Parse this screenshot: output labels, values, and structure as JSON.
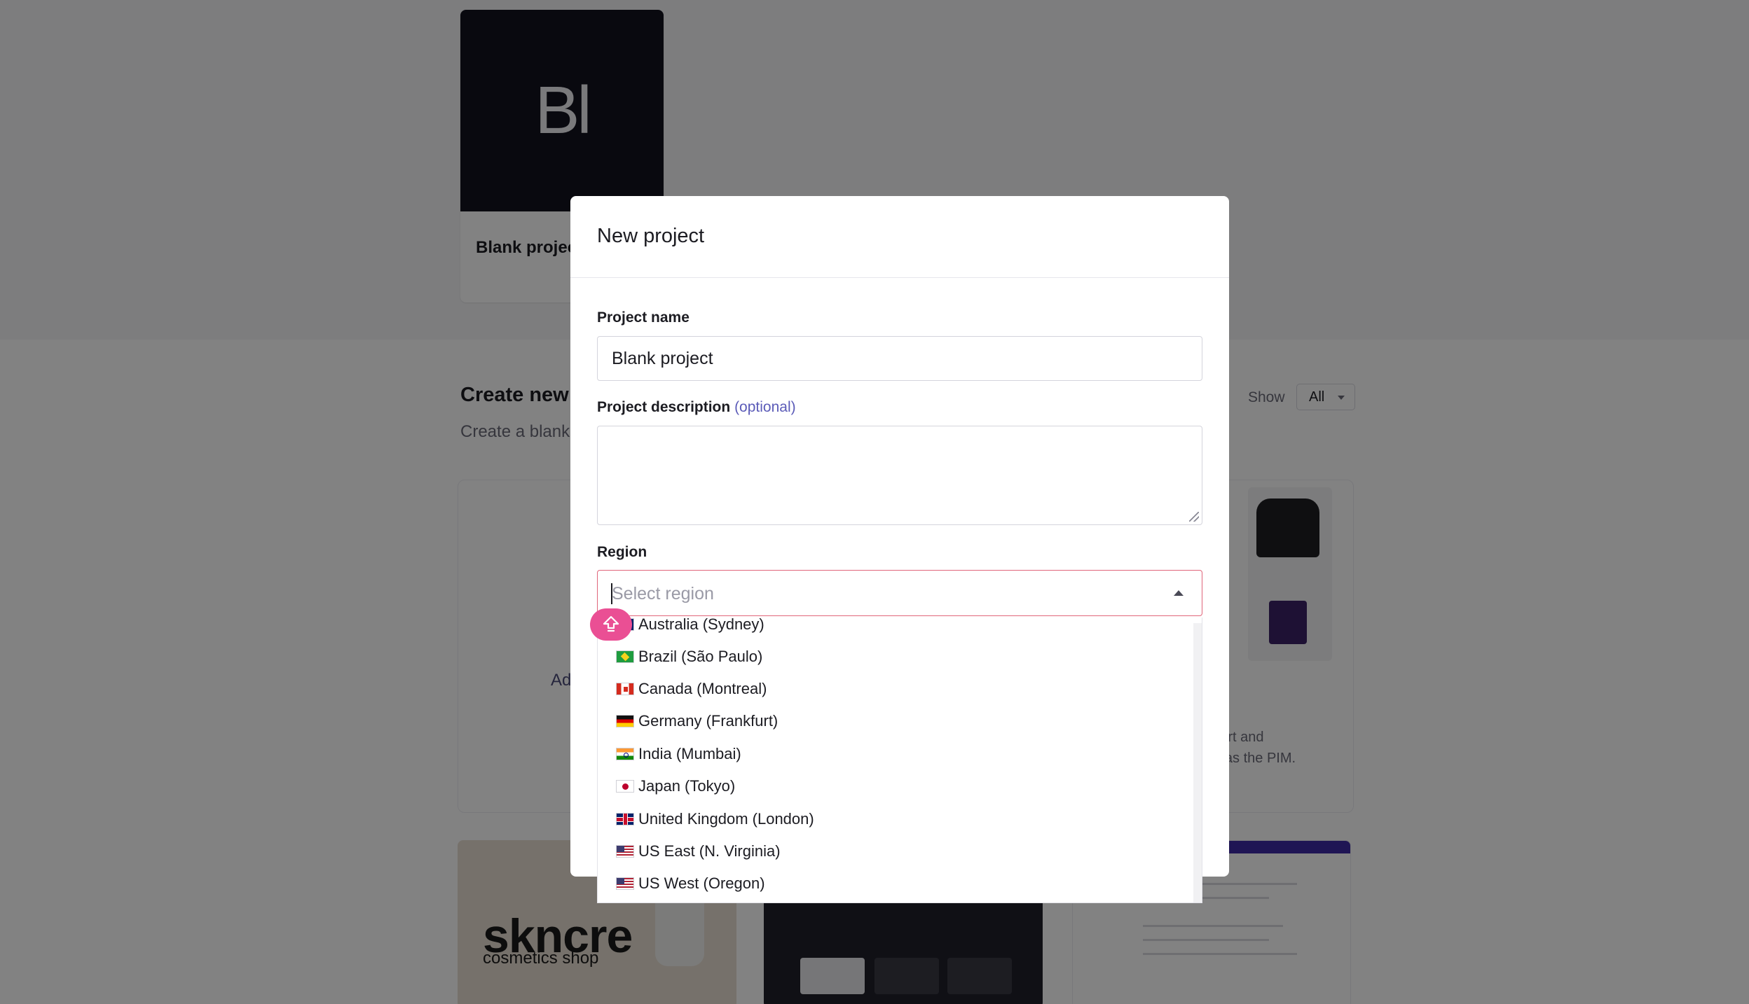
{
  "background": {
    "blank_card": {
      "thumb_text": "Bl",
      "title": "Blank projec"
    },
    "section": {
      "title": "Create new",
      "subtitle": "Create a blank",
      "show_label": "Show",
      "show_value": "All"
    },
    "template_card_a": {
      "text": "Ad"
    },
    "template_card_b": {
      "description_line1": "th cart and",
      "description_line2": "aph as the PIM."
    },
    "bottom_cards": {
      "brand": "skncre",
      "brand_sub": "cosmetics shop"
    }
  },
  "modal": {
    "title": "New project",
    "project_name_label": "Project name",
    "project_name_value": "Blank project",
    "description_label": "Project description",
    "description_optional": "(optional)",
    "region_label": "Region",
    "region_placeholder": "Select region"
  },
  "regions": [
    {
      "label": "Australia (Sydney)",
      "icon": "au-flag-icon"
    },
    {
      "label": "Brazil (São Paulo)",
      "icon": "br-flag-icon"
    },
    {
      "label": "Canada (Montreal)",
      "icon": "ca-flag-icon"
    },
    {
      "label": "Germany (Frankfurt)",
      "icon": "de-flag-icon"
    },
    {
      "label": "India (Mumbai)",
      "icon": "in-flag-icon"
    },
    {
      "label": "Japan (Tokyo)",
      "icon": "jp-flag-icon"
    },
    {
      "label": "United Kingdom (London)",
      "icon": "gb-flag-icon"
    },
    {
      "label": "US East (N. Virginia)",
      "icon": "us-flag-icon"
    },
    {
      "label": "US West (Oregon)",
      "icon": "us-flag-icon"
    }
  ],
  "colors": {
    "accent_pink": "#ea4f94",
    "select_border": "#e0657a",
    "optional_text": "#5b5bb8"
  }
}
